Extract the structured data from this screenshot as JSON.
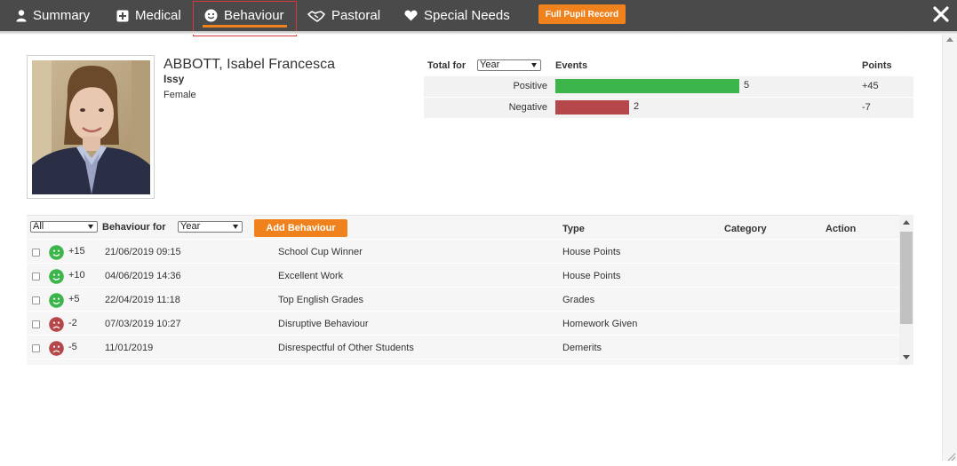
{
  "nav": {
    "tabs": [
      {
        "label": "Summary",
        "icon": "user-icon"
      },
      {
        "label": "Medical",
        "icon": "plus-square-icon"
      },
      {
        "label": "Behaviour",
        "icon": "smile-icon",
        "active": true
      },
      {
        "label": "Pastoral",
        "icon": "handshake-icon"
      },
      {
        "label": "Special Needs",
        "icon": "heart-icon"
      }
    ],
    "full_record_label": "Full Pupil Record",
    "close_icon": "close-icon"
  },
  "pupil": {
    "name": "ABBOTT, Isabel Francesca",
    "nickname": "Issy",
    "gender": "Female"
  },
  "totals": {
    "label": "Total for",
    "period": "Year",
    "events_header": "Events",
    "points_header": "Points",
    "rows": [
      {
        "name": "Positive",
        "events": "5",
        "points": "+45",
        "color": "#3cb54a"
      },
      {
        "name": "Negative",
        "events": "2",
        "points": "-7",
        "color": "#b5474a"
      }
    ]
  },
  "behaviour": {
    "filter": "All",
    "label": "Behaviour for",
    "period": "Year",
    "add_label": "Add Behaviour",
    "headers": {
      "type": "Type",
      "category": "Category",
      "action": "Action"
    },
    "rows": [
      {
        "sentiment": "positive",
        "points": "+15",
        "date": "21/06/2019 09:15",
        "description": "School Cup Winner",
        "type": "House Points"
      },
      {
        "sentiment": "positive",
        "points": "+10",
        "date": "04/06/2019 14:36",
        "description": "Excellent Work",
        "type": "House Points"
      },
      {
        "sentiment": "positive",
        "points": "+5",
        "date": "22/04/2019 11:18",
        "description": "Top English Grades",
        "type": "Grades"
      },
      {
        "sentiment": "negative",
        "points": "-2",
        "date": "07/03/2019 10:27",
        "description": "Disruptive Behaviour",
        "type": "Homework Given"
      },
      {
        "sentiment": "negative",
        "points": "-5",
        "date": "11/01/2019",
        "description": "Disrespectful of Other Students",
        "type": "Demerits"
      }
    ]
  },
  "colors": {
    "topbar": "#4a4a4a",
    "accent": "#f0821e",
    "positive": "#3cb54a",
    "negative": "#b5474a"
  }
}
